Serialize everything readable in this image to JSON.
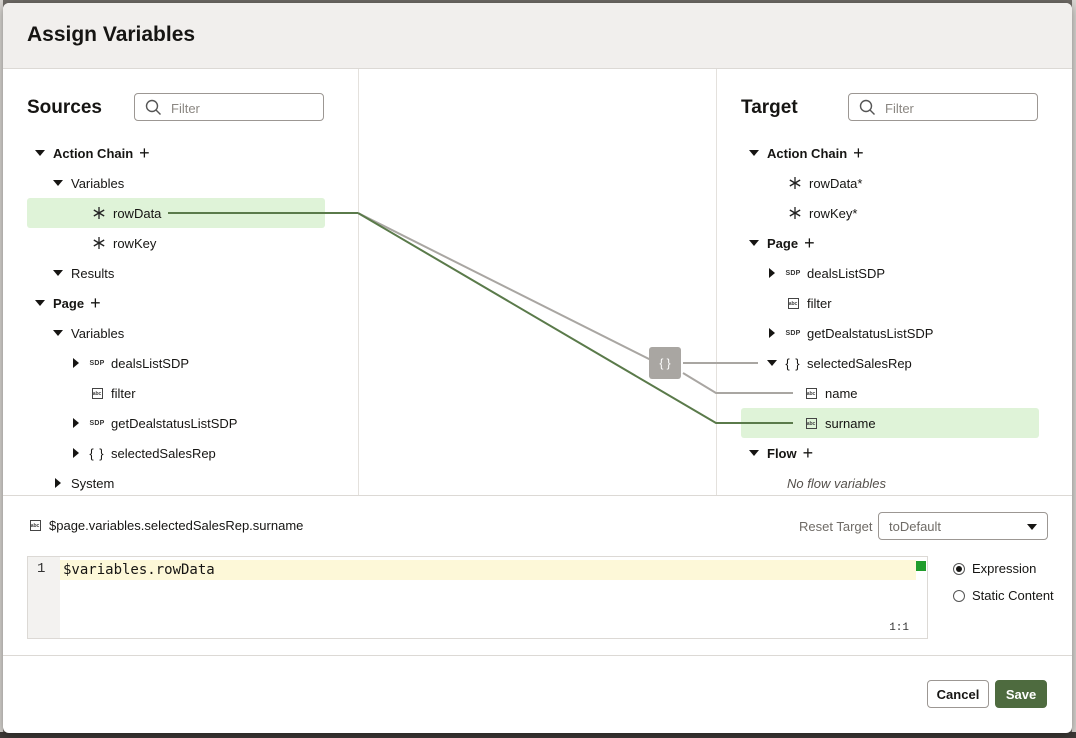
{
  "dialog": {
    "title": "Assign Variables"
  },
  "sources": {
    "title": "Sources",
    "filter_placeholder": "Filter",
    "tree": {
      "action_chain": "Action Chain",
      "variables": "Variables",
      "rowData": "rowData",
      "rowKey": "rowKey",
      "results": "Results",
      "page": "Page",
      "page_variables": "Variables",
      "dealsListSDP": "dealsListSDP",
      "filter": "filter",
      "getDealstatusListSDP": "getDealstatusListSDP",
      "selectedSalesRep": "selectedSalesRep",
      "system": "System"
    }
  },
  "mapping": {
    "node_label": "{ }"
  },
  "target": {
    "title": "Target",
    "filter_placeholder": "Filter",
    "tree": {
      "action_chain": "Action Chain",
      "rowData": "rowData*",
      "rowKey": "rowKey*",
      "page": "Page",
      "dealsListSDP": "dealsListSDP",
      "filter": "filter",
      "getDealstatusListSDP": "getDealstatusListSDP",
      "selectedSalesRep": "selectedSalesRep",
      "name": "name",
      "surname": "surname",
      "flow": "Flow",
      "no_flow": "No flow variables"
    }
  },
  "icons": {
    "sdp": "SDP",
    "abc": "abc",
    "braces": "{ }"
  },
  "expression": {
    "path": "$page.variables.selectedSalesRep.surname",
    "reset_label": "Reset Target",
    "reset_value": "toDefault",
    "line_number": "1",
    "code": "$variables.rowData",
    "cursor": "1:1",
    "mode_expression": "Expression",
    "mode_static": "Static Content"
  },
  "buttons": {
    "cancel": "Cancel",
    "save": "Save"
  },
  "colors": {
    "accent": "#4e6b3f",
    "highlight": "#dff3d8",
    "connector_active": "#5a7a4a",
    "connector_inactive": "#a9a6a2"
  }
}
